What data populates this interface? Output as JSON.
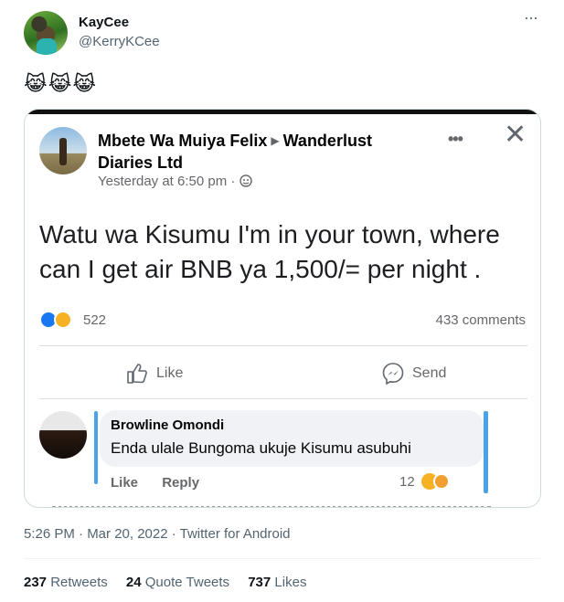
{
  "tweet": {
    "display_name": "KayCee",
    "handle": "@KerryKCee",
    "body_emoji": "😹😹😹",
    "timestamp": "5:26 PM · Mar 20, 2022 · Twitter for Android",
    "stats": {
      "retweets_count": "237",
      "retweets_label": "Retweets",
      "quote_tweets_count": "24",
      "quote_tweets_label": "Quote Tweets",
      "likes_count": "737",
      "likes_label": "Likes"
    }
  },
  "fb_post": {
    "author": "Mbete Wa Muiya Felix",
    "group": "Wanderlust Diaries Ltd",
    "time": "Yesterday at 6:50 pm ·",
    "text": "Watu wa Kisumu I'm in your town, where can I get air BNB ya 1,500/= per night .",
    "reaction_count": "522",
    "comments_count": "433 comments",
    "like_label": "Like",
    "send_label": "Send",
    "comment": {
      "author": "Browline Omondi",
      "text": "Enda ulale Bungoma ukuje Kisumu asubuhi",
      "like_label": "Like",
      "reply_label": "Reply",
      "reaction_count": "12"
    }
  },
  "icons": [
    "more-icon",
    "close-icon",
    "globe-icon",
    "like-icon",
    "messenger-icon",
    "like-reaction-icon",
    "haha-reaction-icon"
  ],
  "colors": {
    "facebook_blue": "#1877f2",
    "haha_yellow": "#f7b125",
    "muted_text": "#536471",
    "annotation_blue": "#4aa3e8"
  }
}
